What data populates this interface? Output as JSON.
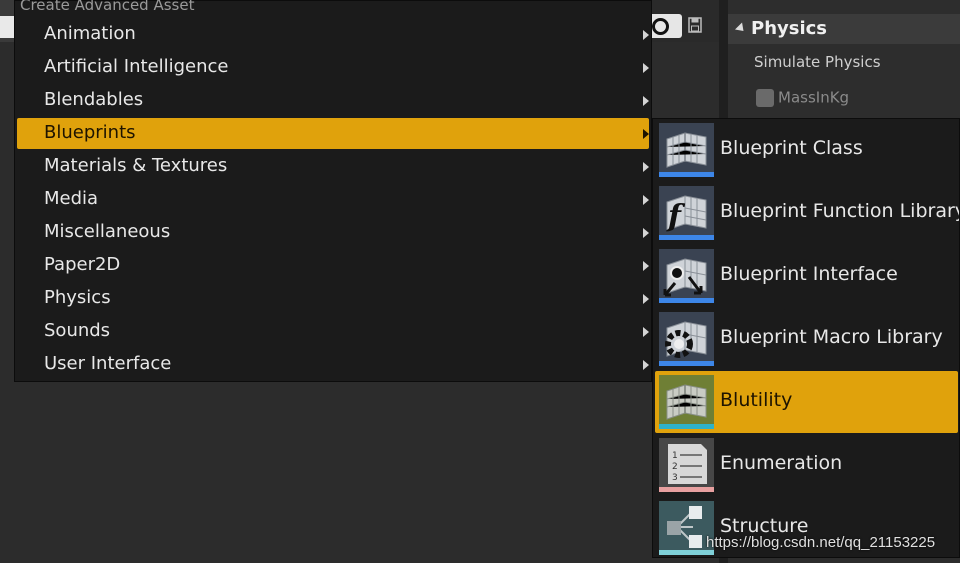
{
  "menu": {
    "heading": "Create Advanced Asset",
    "items": [
      {
        "label": "Animation"
      },
      {
        "label": "Artificial Intelligence"
      },
      {
        "label": "Blendables"
      },
      {
        "label": "Blueprints"
      },
      {
        "label": "Materials & Textures"
      },
      {
        "label": "Media"
      },
      {
        "label": "Miscellaneous"
      },
      {
        "label": "Paper2D"
      },
      {
        "label": "Physics"
      },
      {
        "label": "Sounds"
      },
      {
        "label": "User Interface"
      }
    ],
    "highlighted_item": "Blueprints",
    "highlight_color": "#e0a20c"
  },
  "submenu": {
    "items": [
      {
        "label": "Blueprint Class",
        "icon": "blueprint-grid-icon",
        "bar_color": "#3d86e8"
      },
      {
        "label": "Blueprint Function Library",
        "icon": "blueprint-function-icon",
        "bar_color": "#3d86e8"
      },
      {
        "label": "Blueprint Interface",
        "icon": "blueprint-interface-icon",
        "bar_color": "#3d86e8"
      },
      {
        "label": "Blueprint Macro Library",
        "icon": "blueprint-macro-gear-icon",
        "bar_color": "#3d86e8"
      },
      {
        "label": "Blutility",
        "icon": "blutility-grid-icon",
        "bar_color": "#2fb2c9"
      },
      {
        "label": "Enumeration",
        "icon": "enumeration-list-icon",
        "bar_color": "#e8a0a0"
      },
      {
        "label": "Structure",
        "icon": "structure-blocks-icon",
        "bar_color": "#7fd0d8"
      }
    ],
    "highlighted_item": "Blutility"
  },
  "details": {
    "section_title": "Physics",
    "simulate_label": "Simulate Physics",
    "mass_label": "MassInKg"
  },
  "toolbar": {
    "search_icon": "search-icon",
    "save_icon": "save-icon"
  },
  "watermark": "https://blog.csdn.net/qq_21153225"
}
